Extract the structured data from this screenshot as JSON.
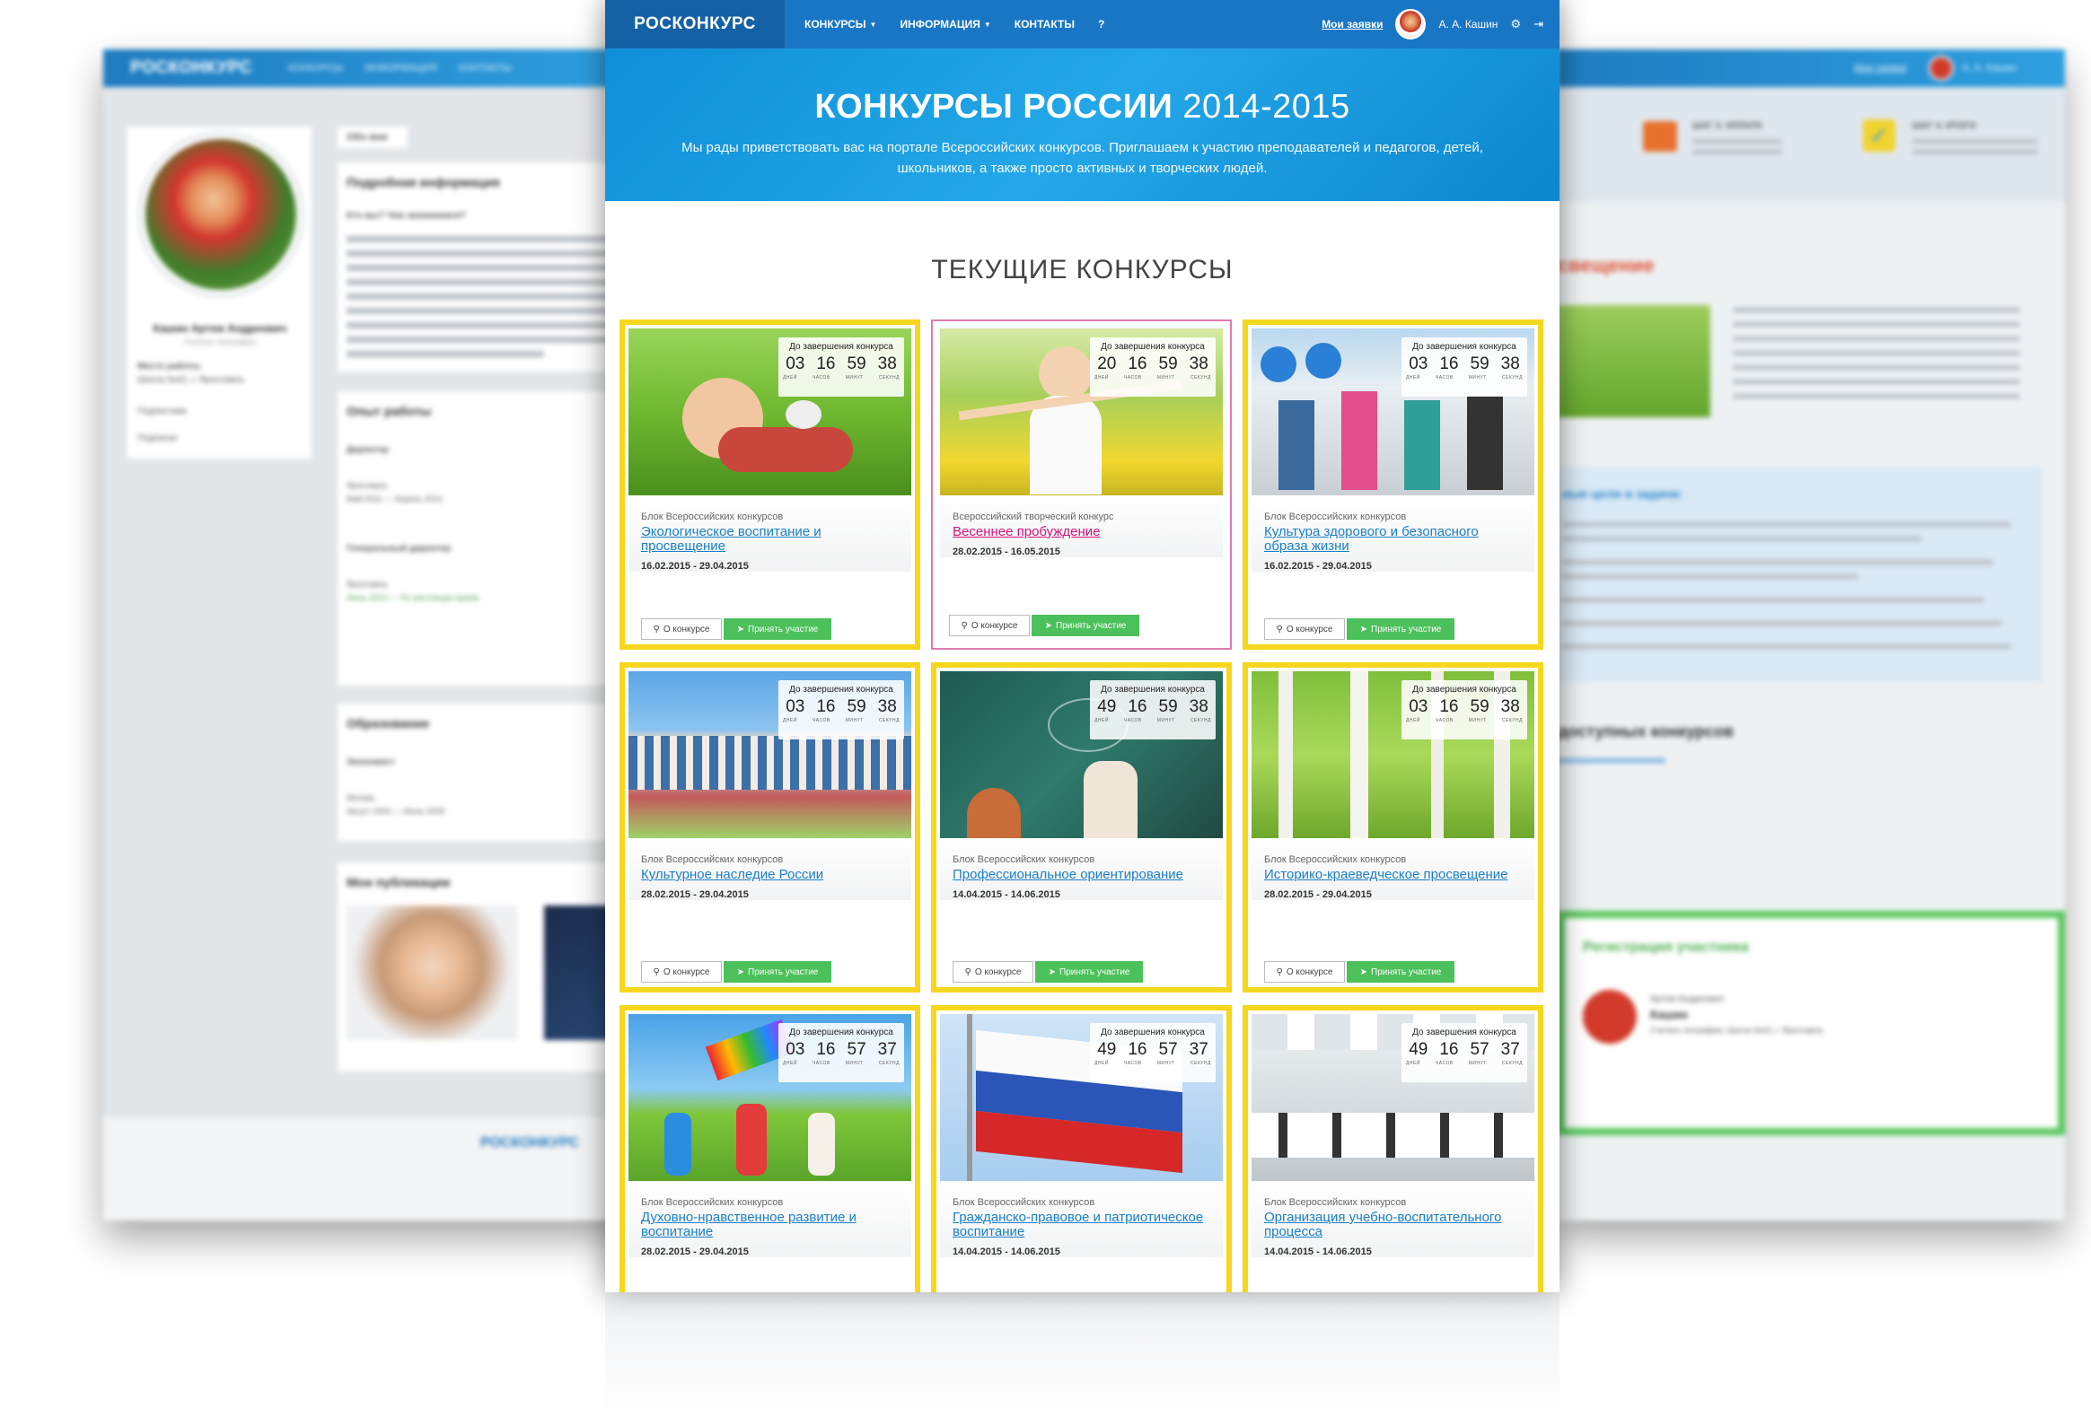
{
  "nav": {
    "brand": "РОСКОНКУРС",
    "menu": [
      "КОНКУРСЫ",
      "ИНФОРМАЦИЯ",
      "КОНТАКТЫ",
      "?"
    ],
    "my_requests": "Мои заявки",
    "user_name": "А. А. Кашин"
  },
  "hero": {
    "title": "КОНКУРСЫ РОССИИ",
    "years": "2014-2015",
    "subtitle": "Мы рады приветствовать вас на портале Всероссийских конкурсов. Приглашаем к участию преподавателей и педагогов, детей, школьников, а также просто активных и творческих людей."
  },
  "section_title": "ТЕКУЩИЕ КОНКУРСЫ",
  "timer": {
    "label": "До завершения конкурса",
    "units": [
      "ДНЕЙ",
      "ЧАСОВ",
      "МИНУТ",
      "СЕКУНД"
    ]
  },
  "buttons": {
    "about": "О конкурсе",
    "join": "Принять участие"
  },
  "contests": [
    {
      "category": "Блок Всероссийских конкурсов",
      "title": "Экологическое воспитание и просвещение",
      "dates": "16.02.2015 - 29.04.2015",
      "timer": [
        "03",
        "16",
        "59",
        "38"
      ]
    },
    {
      "category": "Всероссийский творческий конкурс",
      "title": "Весеннее пробуждение",
      "dates": "28.02.2015 - 16.05.2015",
      "timer": [
        "20",
        "16",
        "59",
        "38"
      ]
    },
    {
      "category": "Блок Всероссийских конкурсов",
      "title": "Культура здорового и безопасного образа жизни",
      "dates": "16.02.2015 - 29.04.2015",
      "timer": [
        "03",
        "16",
        "59",
        "38"
      ]
    },
    {
      "category": "Блок Всероссийских конкурсов",
      "title": "Культурное наследие России",
      "dates": "28.02.2015 - 29.04.2015",
      "timer": [
        "03",
        "16",
        "59",
        "38"
      ]
    },
    {
      "category": "Блок Всероссийских конкурсов",
      "title": "Профессиональное ориентирование",
      "dates": "14.04.2015 - 14.06.2015",
      "timer": [
        "49",
        "16",
        "59",
        "38"
      ]
    },
    {
      "category": "Блок Всероссийских конкурсов",
      "title": "Историко-краеведческое просвещение",
      "dates": "28.02.2015 - 29.04.2015",
      "timer": [
        "03",
        "16",
        "59",
        "38"
      ]
    },
    {
      "category": "Блок Всероссийских конкурсов",
      "title": "Духовно-нравственное развитие и воспитание",
      "dates": "28.02.2015 - 29.04.2015",
      "timer": [
        "03",
        "16",
        "57",
        "37"
      ]
    },
    {
      "category": "Блок Всероссийских конкурсов",
      "title": "Гражданско-правовое и патриотическое воспитание",
      "dates": "14.04.2015 - 14.06.2015",
      "timer": [
        "49",
        "16",
        "57",
        "37"
      ]
    },
    {
      "category": "Блок Всероссийских конкурсов",
      "title": "Организация учебно-воспитательного процесса",
      "dates": "14.04.2015 - 14.06.2015",
      "timer": [
        "49",
        "16",
        "57",
        "37"
      ]
    }
  ],
  "left_page": {
    "brand": "РОСКОНКУРС",
    "menu": [
      "КОНКУРСЫ",
      "ИНФОРМАЦИЯ",
      "КОНТАКТЫ"
    ],
    "profile_name": "Кашин Артем Андреевич",
    "profile_role": "Учитель географии",
    "workplace_label": "Место работы",
    "workplace": "Школа №42, г. Ярославль",
    "subscribers": "Подписчики",
    "subscriptions": "Подписки",
    "tab_about": "Обо мне",
    "section_details": "Подробная информация",
    "who_we_are": "Кто мы? Чем занимаемся?",
    "section_experience": "Опыт работы",
    "job1": "Директор",
    "job1_place": "Ярославль",
    "job1_period": "Май 2011 — Апрель 2014",
    "job2": "Генеральный директор",
    "job2_place": "Ярославль",
    "job2_period": "Июнь 2014 — По настоящее время",
    "section_education": "Образование",
    "edu": "Экономист",
    "edu_place": "Москва",
    "edu_period": "Август 2004 — Июль 2009",
    "section_publications": "Мои публикации",
    "footer_brand": "РОСКОНКУРС"
  },
  "right_page": {
    "my_requests": "Мои заявки",
    "user_name": "А. А. Кашин",
    "step3_title": "ШАГ 3. ОПЛАТА",
    "step4_title": "ШАГ 4. ИТОГИ",
    "heading": "свещение",
    "goals": "ные цели и задачи:",
    "available": "доступных конкурсов",
    "registration": "Регистрация участника",
    "reg_first": "Артем Андреевич",
    "reg_last": "Кашин",
    "reg_info": "Учитель географии, Школа №42, г. Ярославль"
  }
}
